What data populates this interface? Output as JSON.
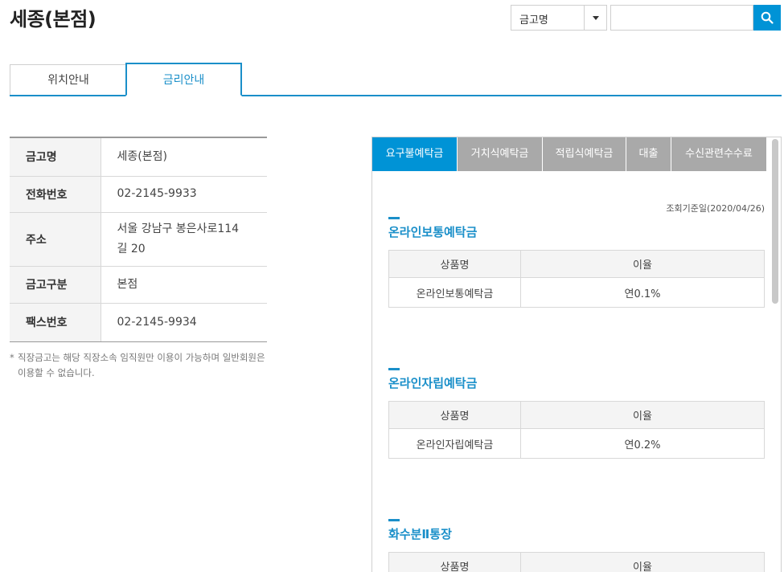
{
  "header": {
    "title": "세종(본점)",
    "search": {
      "select_value": "금고명",
      "input_value": "",
      "button_icon": "search-icon"
    }
  },
  "main_tabs": [
    {
      "label": "위치안내",
      "active": false
    },
    {
      "label": "금리안내",
      "active": true
    }
  ],
  "info": {
    "rows": [
      {
        "label": "금고명",
        "value": "세종(본점)"
      },
      {
        "label": "전화번호",
        "value": "02-2145-9933"
      },
      {
        "label": "주소",
        "value": "서울 강남구 봉은사로114\n길 20"
      },
      {
        "label": "금고구분",
        "value": "본점"
      },
      {
        "label": "팩스번호",
        "value": "02-2145-9934"
      }
    ],
    "note": "직장금고는 해당 직장소속 임직원만 이용이 가능하며 일반회원은 이용할 수 없습니다."
  },
  "rate_tabs": [
    {
      "label": "요구불예탁금",
      "active": true
    },
    {
      "label": "거치식예탁금",
      "active": false
    },
    {
      "label": "적립식예탁금",
      "active": false
    },
    {
      "label": "대출",
      "active": false
    },
    {
      "label": "수신관련수수료",
      "active": false
    }
  ],
  "base_date": "조회기준일(2020/04/26)",
  "sections": [
    {
      "title": "온라인보통예탁금",
      "col_product": "상품명",
      "col_rate": "이율",
      "product": "온라인보통예탁금",
      "rate": "연0.1%"
    },
    {
      "title": "온라인자립예탁금",
      "col_product": "상품명",
      "col_rate": "이율",
      "product": "온라인자립예탁금",
      "rate": "연0.2%"
    },
    {
      "title": "화수분Ⅱ통장",
      "col_product": "상품명",
      "col_rate": "이율"
    }
  ],
  "colors": {
    "accent": "#0093d6",
    "tab_inactive": "#a9a9a9",
    "title_blue": "#1a8fc9"
  }
}
